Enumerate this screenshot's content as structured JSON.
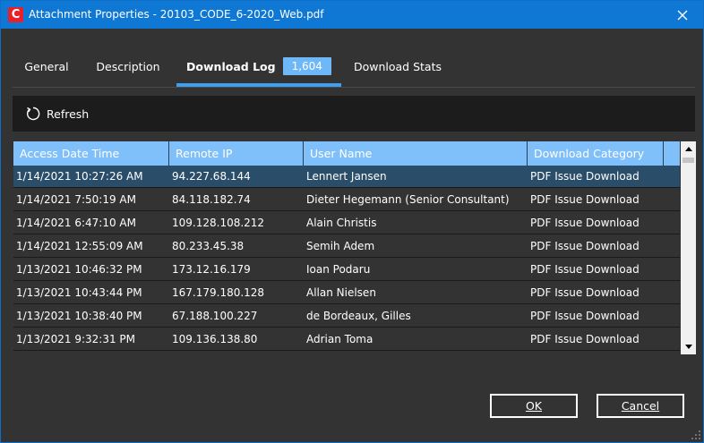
{
  "window": {
    "title": "Attachment Properties - 20103_CODE_6-2020_Web.pdf",
    "app_icon_letter": "C",
    "accent": "#0e78d4"
  },
  "tabs": [
    {
      "label": "General",
      "active": false
    },
    {
      "label": "Description",
      "active": false
    },
    {
      "label": "Download Log",
      "active": true,
      "badge": "1,604"
    },
    {
      "label": "Download Stats",
      "active": false
    }
  ],
  "toolbar": {
    "refresh_label": "Refresh",
    "refresh_icon": "refresh-icon"
  },
  "grid": {
    "columns": [
      "Access Date Time",
      "Remote IP",
      "User Name",
      "Download Category"
    ],
    "rows": [
      [
        "1/14/2021 10:27:26 AM",
        "94.227.68.144",
        "Lennert Jansen",
        "PDF Issue Download"
      ],
      [
        "1/14/2021 7:50:19 AM",
        "84.118.182.74",
        "Dieter Hegemann (Senior Consultant)",
        "PDF Issue Download"
      ],
      [
        "1/14/2021 6:47:10 AM",
        "109.128.108.212",
        "Alain Christis",
        "PDF Issue Download"
      ],
      [
        "1/14/2021 12:55:09 AM",
        "80.233.45.38",
        "Semih Adem",
        "PDF Issue Download"
      ],
      [
        "1/13/2021 10:46:32 PM",
        "173.12.16.179",
        "Ioan Podaru",
        "PDF Issue Download"
      ],
      [
        "1/13/2021 10:43:44 PM",
        "167.179.180.128",
        "Allan Nielsen",
        "PDF Issue Download"
      ],
      [
        "1/13/2021 10:38:40 PM",
        "67.188.100.227",
        "de Bordeaux, Gilles",
        "PDF Issue Download"
      ],
      [
        "1/13/2021 9:32:31 PM",
        "109.136.138.80",
        "Adrian Toma",
        "PDF Issue Download"
      ]
    ],
    "selected_row": 0
  },
  "buttons": {
    "ok": "OK",
    "cancel": "Cancel"
  }
}
